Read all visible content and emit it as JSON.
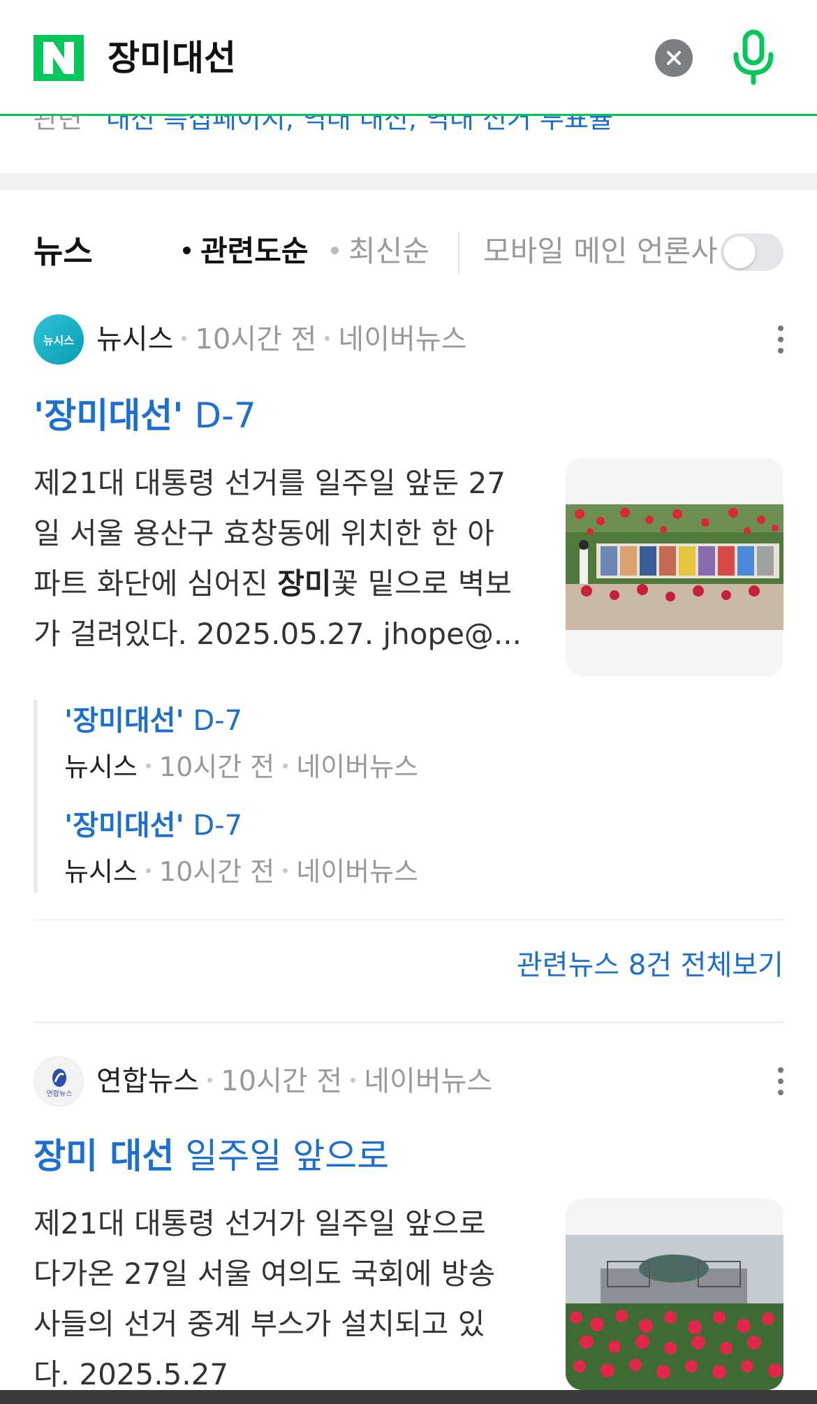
{
  "header": {
    "query": "장미대선",
    "brand_color": "#03c75a"
  },
  "related_peek": {
    "label": "관련",
    "links": "대선 특집페이지, 역대 대선, 역대 선거 투표율"
  },
  "news": {
    "title": "뉴스",
    "sort_relevance": "관련도순",
    "sort_latest": "최신순",
    "mobile_main_label": "모바일 메인 언론사",
    "mobile_main_toggle": "off"
  },
  "articles": [
    {
      "press": "뉴시스",
      "press_logo_text": "뉴시스",
      "time": "10시간 전",
      "source": "네이버뉴스",
      "headline_bold": "'장미대선'",
      "headline_rest": " D-7",
      "body_1": "제21대 대통령 선거를 일주일 앞둔 27",
      "body_2": "일 서울 용산구 효창동에 위치한 한 아",
      "body_3a": "파트 화단에 심어진 ",
      "body_3b": "장미",
      "body_3c": "꽃 밑으로 벽보",
      "body_4": "가 걸려있다. 2025.05.27. jhope@...",
      "related": [
        {
          "title_bold": "'장미대선'",
          "title_rest": " D-7",
          "press": "뉴시스",
          "time": "10시간 전",
          "source": "네이버뉴스"
        },
        {
          "title_bold": "'장미대선'",
          "title_rest": " D-7",
          "press": "뉴시스",
          "time": "10시간 전",
          "source": "네이버뉴스"
        }
      ],
      "all_related": "관련뉴스 8건 전체보기"
    },
    {
      "press": "연합뉴스",
      "press_logo_text": "연합뉴스",
      "time": "10시간 전",
      "source": "네이버뉴스",
      "headline_bold": "장미 대선",
      "headline_rest": " 일주일 앞으로",
      "body_1": "제21대 대통령 선거가 일주일 앞으로",
      "body_2": "다가온 27일 서울 여의도 국회에 방송",
      "body_3": "사들의 선거 중계 부스가 설치되고 있",
      "body_4": "다. 2025.5.27"
    }
  ]
}
